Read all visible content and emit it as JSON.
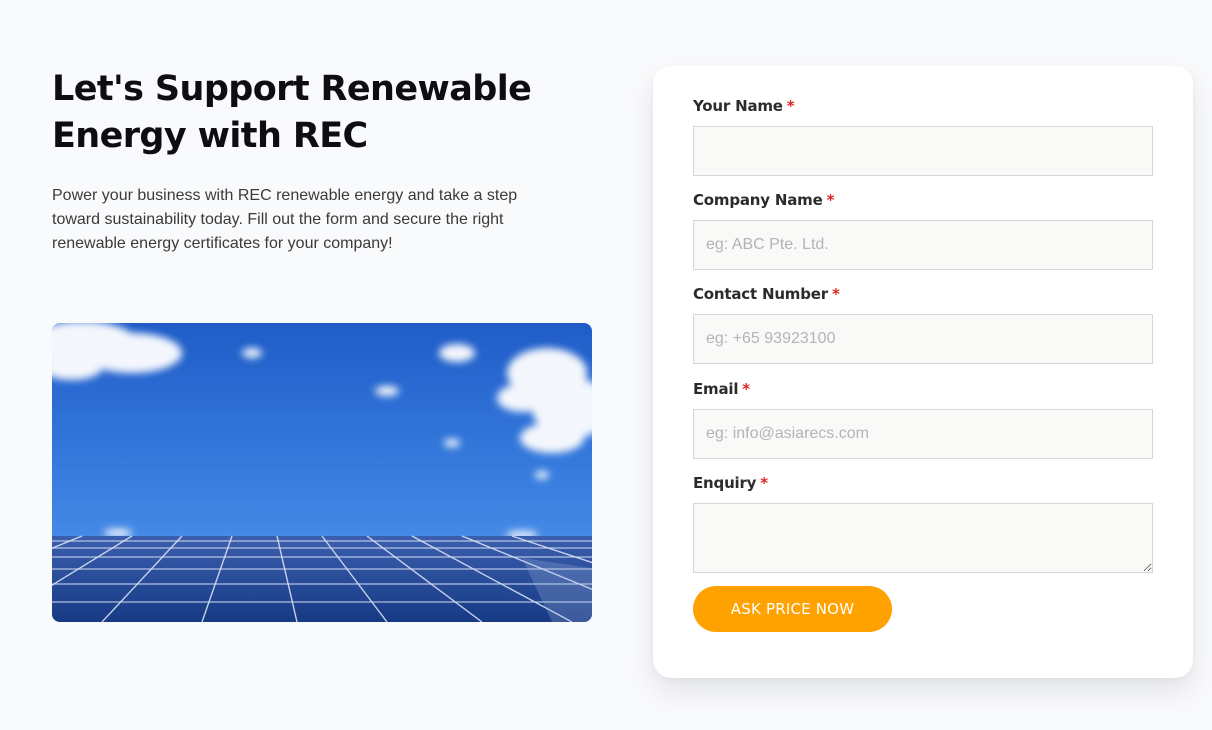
{
  "intro": {
    "heading": "Let's Support Renewable Energy with REC",
    "body": "Power your business with REC renewable energy and take a step toward sustainability today. Fill out the form and secure the right renewable energy certificates for your company!"
  },
  "form": {
    "required_marker": "*",
    "fields": [
      {
        "label": "Your Name",
        "placeholder": "",
        "value": ""
      },
      {
        "label": "Company Name",
        "placeholder": "eg: ABC Pte. Ltd.",
        "value": ""
      },
      {
        "label": "Contact Number",
        "placeholder": "eg: +65 93923100",
        "value": ""
      },
      {
        "label": "Email",
        "placeholder": "eg: info@asiarecs.com",
        "value": ""
      },
      {
        "label": "Enquiry",
        "placeholder": "",
        "value": ""
      }
    ],
    "submit_label": "ASK PRICE NOW"
  },
  "colors": {
    "page_background": "#f9fafc",
    "accent": "#ffa200",
    "required": "#e02424",
    "sky": "#2f6fd6",
    "panel": "#1c3f86"
  },
  "image": {
    "subject": "solar panels under blue sky"
  }
}
